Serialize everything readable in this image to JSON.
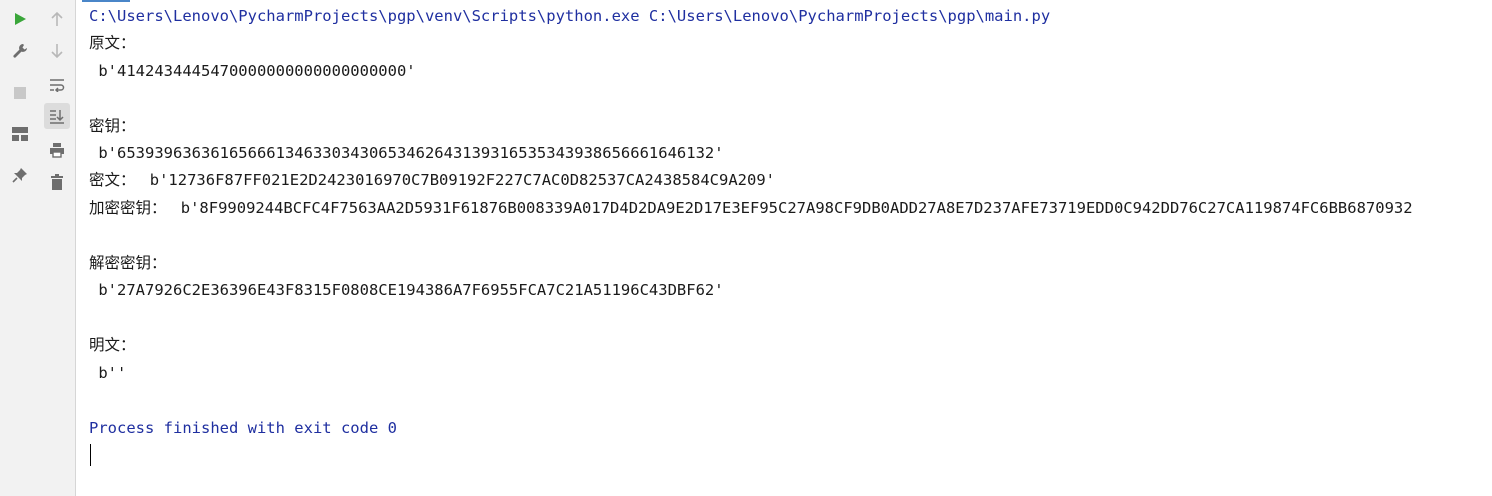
{
  "console": {
    "command": "C:\\Users\\Lenovo\\PycharmProjects\\pgp\\venv\\Scripts\\python.exe C:\\Users\\Lenovo\\PycharmProjects\\pgp\\main.py",
    "plaintext_label": "原文：",
    "plaintext_value": " b'4142434445470000000000000000000'",
    "key_label": "密钥：",
    "key_value": " b'6539396363616566613463303430653462643139316535343938656661646132'",
    "ciphertext_label": "密文： ",
    "ciphertext_value": " b'12736F87FF021E2D2423016970C7B09192F227C7AC0D82537CA2438584C9A209'",
    "enc_key_label": "加密密钥： ",
    "enc_key_value": " b'8F9909244BCFC4F7563AA2D5931F61876B008339A017D4D2DA9E2D17E3EF95C27A98CF9DB0ADD27A8E7D237AFE73719EDD0C942DD76C27CA119874FC6BB6870932",
    "dec_key_label": "解密密钥：",
    "dec_key_value": " b'27A7926C2E36396E43F8315F0808CE194386A7F6955FCA7C21A51196C43DBF62'",
    "decrypted_label": "明文：",
    "decrypted_value": " b''",
    "exit_message": "Process finished with exit code 0"
  },
  "toolbar": {
    "left": [
      "run-icon",
      "wrench-icon",
      "stop-icon",
      "layout-icon",
      "pin-icon"
    ],
    "right": [
      "arrow-up-icon",
      "arrow-down-icon",
      "soft-wrap-icon",
      "scroll-to-end-icon",
      "print-icon",
      "trash-icon"
    ]
  },
  "colors": {
    "command_text": "#1f2fa0",
    "run_green": "#3aa63a",
    "toolbar_bg": "#f2f2f2"
  }
}
